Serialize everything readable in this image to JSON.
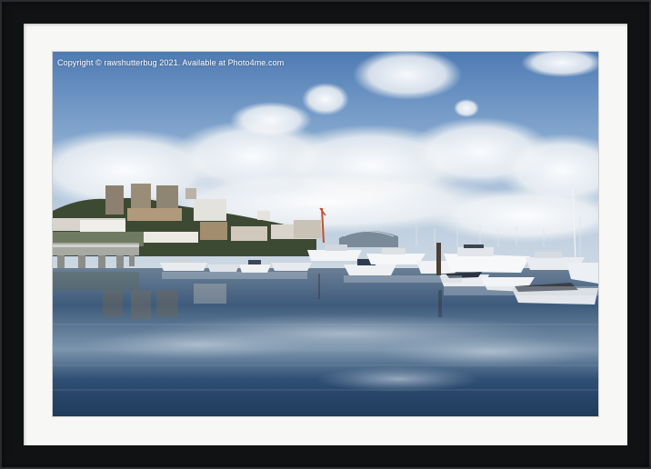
{
  "photo": {
    "copyright_text": "Copyright © rawshutterbug  2021. Available at Photo4me.com"
  },
  "colors": {
    "frame": "#111214",
    "mount": "#f7f7f5",
    "sky_top": "#4f7bb4",
    "water": "#1f3a5c"
  }
}
